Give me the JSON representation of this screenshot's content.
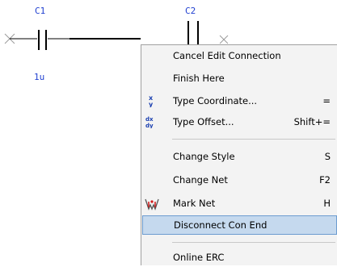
{
  "schematic": {
    "c1_label": "C1",
    "c1_value": "1u",
    "c2_label": "C2",
    "ref_color": "#1f3fd0"
  },
  "menu": {
    "items": [
      {
        "label": "Cancel Edit Connection",
        "shortcut": "",
        "icon": ""
      },
      {
        "label": "Finish Here",
        "shortcut": "",
        "icon": ""
      },
      {
        "label": "Type Coordinate...",
        "shortcut": "=",
        "icon": "coordinate-icon"
      },
      {
        "label": "Type Offset...",
        "shortcut": "Shift+=",
        "icon": "offset-icon"
      },
      {
        "label": "Change Style",
        "shortcut": "S",
        "icon": ""
      },
      {
        "label": "Change Net",
        "shortcut": "F2",
        "icon": ""
      },
      {
        "label": "Mark Net",
        "shortcut": "H",
        "icon": "mark-net-icon"
      },
      {
        "label": "Disconnect Con End",
        "shortcut": "",
        "icon": "",
        "highlighted": true
      },
      {
        "label": "Online ERC",
        "shortcut": "",
        "icon": ""
      }
    ],
    "highlight_color": "#c5d9ee",
    "highlight_border": "#6c9cd0"
  }
}
